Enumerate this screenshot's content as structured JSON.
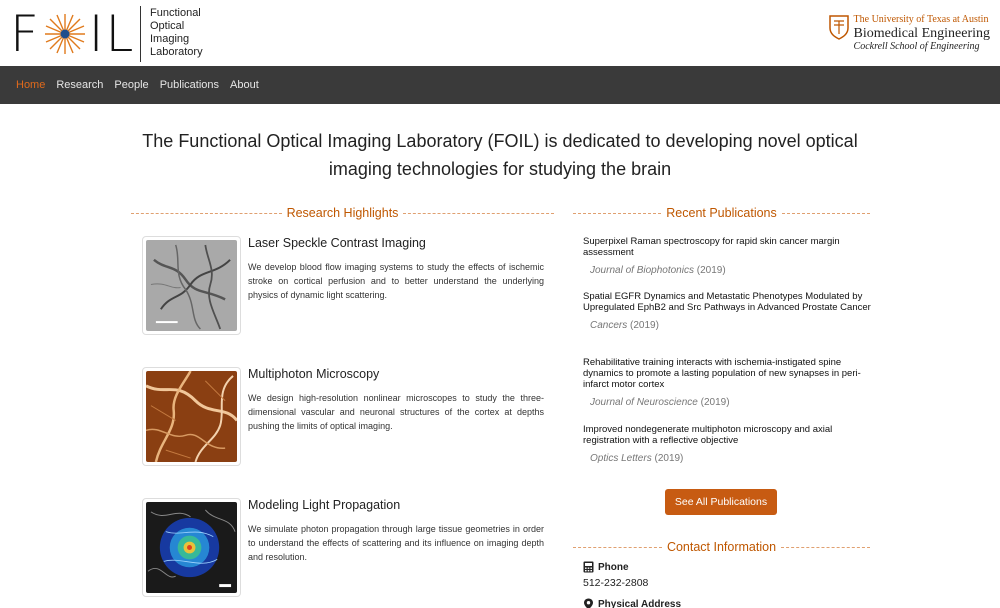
{
  "header": {
    "logo_word_left": "F",
    "logo_word_right": "IL",
    "logo_lines": [
      "Functional",
      "Optical",
      "Imaging",
      "Laboratory"
    ],
    "ut_line1": "The University of Texas at Austin",
    "ut_line2": "Biomedical Engineering",
    "ut_line3": "Cockrell School of Engineering"
  },
  "nav": {
    "items": [
      "Home",
      "Research",
      "People",
      "Publications",
      "About"
    ],
    "active": "Home"
  },
  "headline": {
    "line1": "The Functional Optical Imaging Laboratory (FOIL) is dedicated to developing novel optical",
    "line2": "imaging technologies for studying the brain"
  },
  "research": {
    "section_title": "Research Highlights",
    "items": [
      {
        "title": "Laser Speckle Contrast Imaging",
        "desc": "We develop blood flow imaging systems to study the effects of ischemic stroke on cortical perfusion and to better understand the underlying physics of dynamic light scattering."
      },
      {
        "title": "Multiphoton Microscopy",
        "desc": "We design high-resolution nonlinear microscopes to study the three-dimensional vascular and neuronal structures of the cortex at depths pushing the limits of optical imaging."
      },
      {
        "title": "Modeling Light Propagation",
        "desc": "We simulate photon propagation through large tissue geometries in order to understand the effects of scattering and its influence on imaging depth and resolution."
      }
    ]
  },
  "publications": {
    "section_title": "Recent Publications",
    "items": [
      {
        "title": "Superpixel Raman spectroscopy for rapid skin cancer margin assessment",
        "journal": "Journal of Biophotonics",
        "year": "(2019)"
      },
      {
        "title": "Spatial EGFR Dynamics and Metastatic Phenotypes Modulated by Upregulated EphB2 and Src Pathways in Advanced Prostate Cancer",
        "journal": "Cancers",
        "year": "(2019)"
      },
      {
        "title": "Rehabilitative training interacts with ischemia-instigated spine dynamics to promote a lasting population of new synapses in peri-infarct motor cortex",
        "journal": "Journal of Neuroscience",
        "year": "(2019)"
      },
      {
        "title": "Improved nondegenerate multiphoton microscopy and axial registration with a reflective objective",
        "journal": "Optics Letters",
        "year": "(2019)"
      }
    ],
    "see_all_label": "See All Publications"
  },
  "contact": {
    "section_title": "Contact Information",
    "phone_label": "Phone",
    "phone_value": "512-232-2808",
    "address_label": "Physical Address"
  },
  "colors": {
    "accent": "#bf5700",
    "nav_bg": "#3a3a3a",
    "nav_active": "#e06a1c",
    "button": "#c75b12"
  }
}
